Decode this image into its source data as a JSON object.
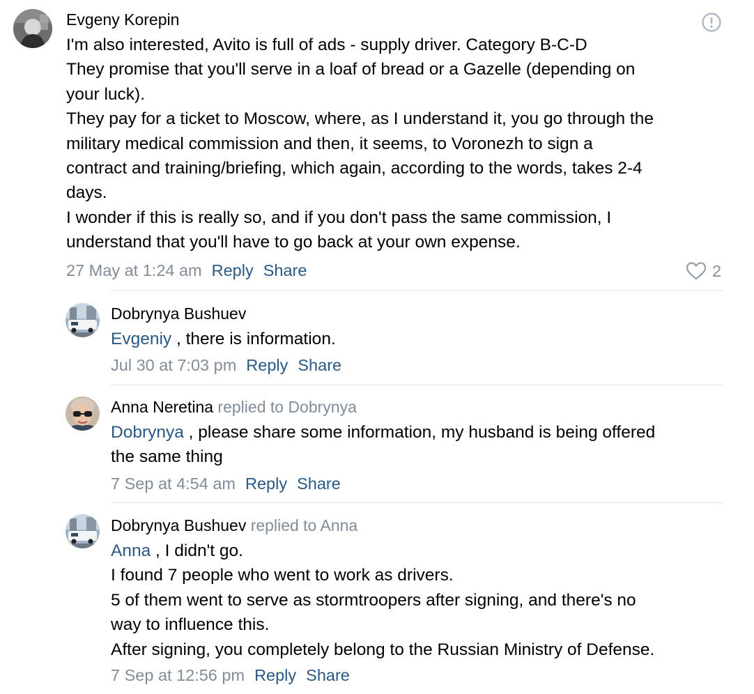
{
  "comments": [
    {
      "author": "Evgeny Korepin",
      "lines": [
        "I'm also interested, Avito is full of ads - supply driver. Category B-C-D",
        "They promise that you'll serve in a loaf of bread or a Gazelle (depending on",
        "your luck).",
        "They pay for a ticket to Moscow, where, as I understand it, you go through the",
        "military medical commission and then, it seems, to Voronezh to sign a",
        "contract and training/briefing, which again, according to the words, takes 2-4",
        "days.",
        "I wonder if this is really so, and if you don't pass the same commission, I",
        "understand that you'll have to go back at your own expense."
      ],
      "timestamp": "27 May at 1:24 am",
      "reply_label": "Reply",
      "share_label": "Share",
      "likes": "2"
    },
    {
      "author": "Dobrynya Bushuev",
      "replied_to": "",
      "mention": "Evgeniy",
      "first_line_rest": " , there is information.",
      "lines": [],
      "timestamp": "Jul 30 at 7:03 pm",
      "reply_label": "Reply",
      "share_label": "Share"
    },
    {
      "author": "Anna Neretina",
      "replied_to": " replied to Dobrynya",
      "mention": "Dobrynya",
      "first_line_rest": " , please share some information, my husband is being offered",
      "lines": [
        "the same thing"
      ],
      "timestamp": "7 Sep at 4:54 am",
      "reply_label": "Reply",
      "share_label": "Share"
    },
    {
      "author": "Dobrynya Bushuev",
      "replied_to": " replied to Anna",
      "mention": "Anna",
      "first_line_rest": " , I didn't go.",
      "lines": [
        "I found 7 people who went to work as drivers.",
        "5 of them went to serve as stormtroopers after signing, and there's no",
        "way to influence this.",
        "After signing, you completely belong to the Russian Ministry of Defense."
      ],
      "timestamp": "7 Sep at 12:56 pm",
      "reply_label": "Reply",
      "share_label": "Share"
    }
  ],
  "icons": {
    "report": "report-icon",
    "like": "heart-icon"
  },
  "colors": {
    "link": "#2a5885",
    "secondary": "#818c99",
    "divider": "#e1e3e6"
  }
}
